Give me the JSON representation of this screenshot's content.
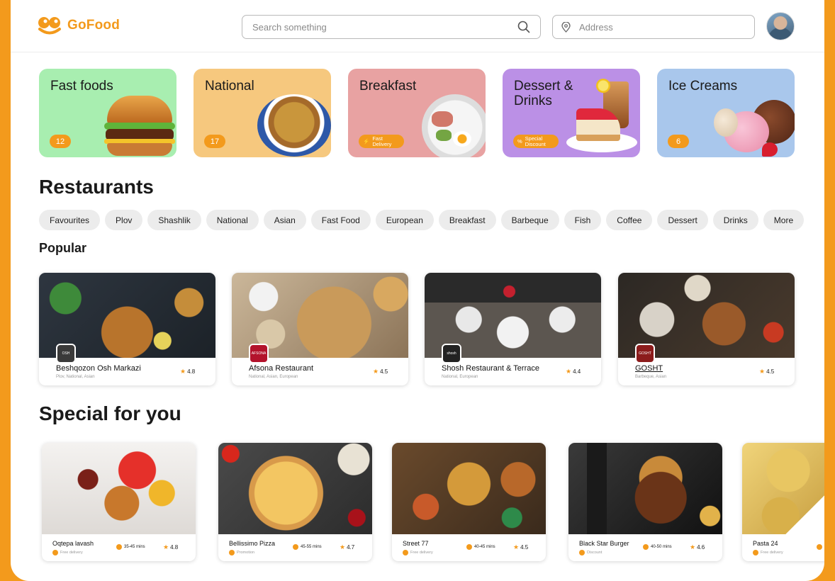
{
  "brand": {
    "name": "GoFood",
    "color": "#F39A1C"
  },
  "header": {
    "search_placeholder": "Search something",
    "address_placeholder": "Address"
  },
  "categories": [
    {
      "title": "Fast foods",
      "badge": "12",
      "bg": "#A8EEB0"
    },
    {
      "title": "National",
      "badge": "17",
      "bg": "#F6C87E"
    },
    {
      "title": "Breakfast",
      "badge": "Fast Delivery",
      "bg": "#E8A2A2"
    },
    {
      "title": "Dessert & Drinks",
      "badge": "Special Discount",
      "bg": "#BB90E6"
    },
    {
      "title": "Ice Creams",
      "badge": "6",
      "bg": "#A9C7EC"
    }
  ],
  "restaurants_title": "Restaurants",
  "filters": [
    "Favourites",
    "Plov",
    "Shashlik",
    "National",
    "Asian",
    "Fast Food",
    "European",
    "Breakfast",
    "Barbeque",
    "Fish",
    "Coffee",
    "Dessert",
    "Drinks",
    "More"
  ],
  "popular_title": "Popular",
  "popular": [
    {
      "name": "Beshqozon Osh Markazi",
      "tags": "Plov, National, Asian",
      "rating": "4.8",
      "logo_text": "OSH"
    },
    {
      "name": "Afsona Restaurant",
      "tags": "National, Asian, European",
      "rating": "4.5",
      "logo_text": "AFSONA"
    },
    {
      "name": "Shosh Restaurant & Terrace",
      "tags": "National, European",
      "rating": "4.4",
      "logo_text": "shosh"
    },
    {
      "name": "GOSHT",
      "tags": "Barbeque, Asian",
      "rating": "4.5",
      "logo_text": "GOSHT"
    }
  ],
  "special_title": "Special for you",
  "special": [
    {
      "name": "Oqtepa lavash",
      "sub": "Free delivery",
      "time": "35-45 mins",
      "rating": "4.8"
    },
    {
      "name": "Bellissimo Pizza",
      "sub": "Promotion",
      "time": "45-55 mins",
      "rating": "4.7"
    },
    {
      "name": "Street 77",
      "sub": "Free delivery",
      "time": "40-45 mins",
      "rating": "4.5"
    },
    {
      "name": "Black Star Burger",
      "sub": "Discount",
      "time": "40-50 mins",
      "rating": "4.6"
    },
    {
      "name": "Pasta 24",
      "sub": "Free delivery",
      "time": "",
      "rating": ""
    }
  ]
}
